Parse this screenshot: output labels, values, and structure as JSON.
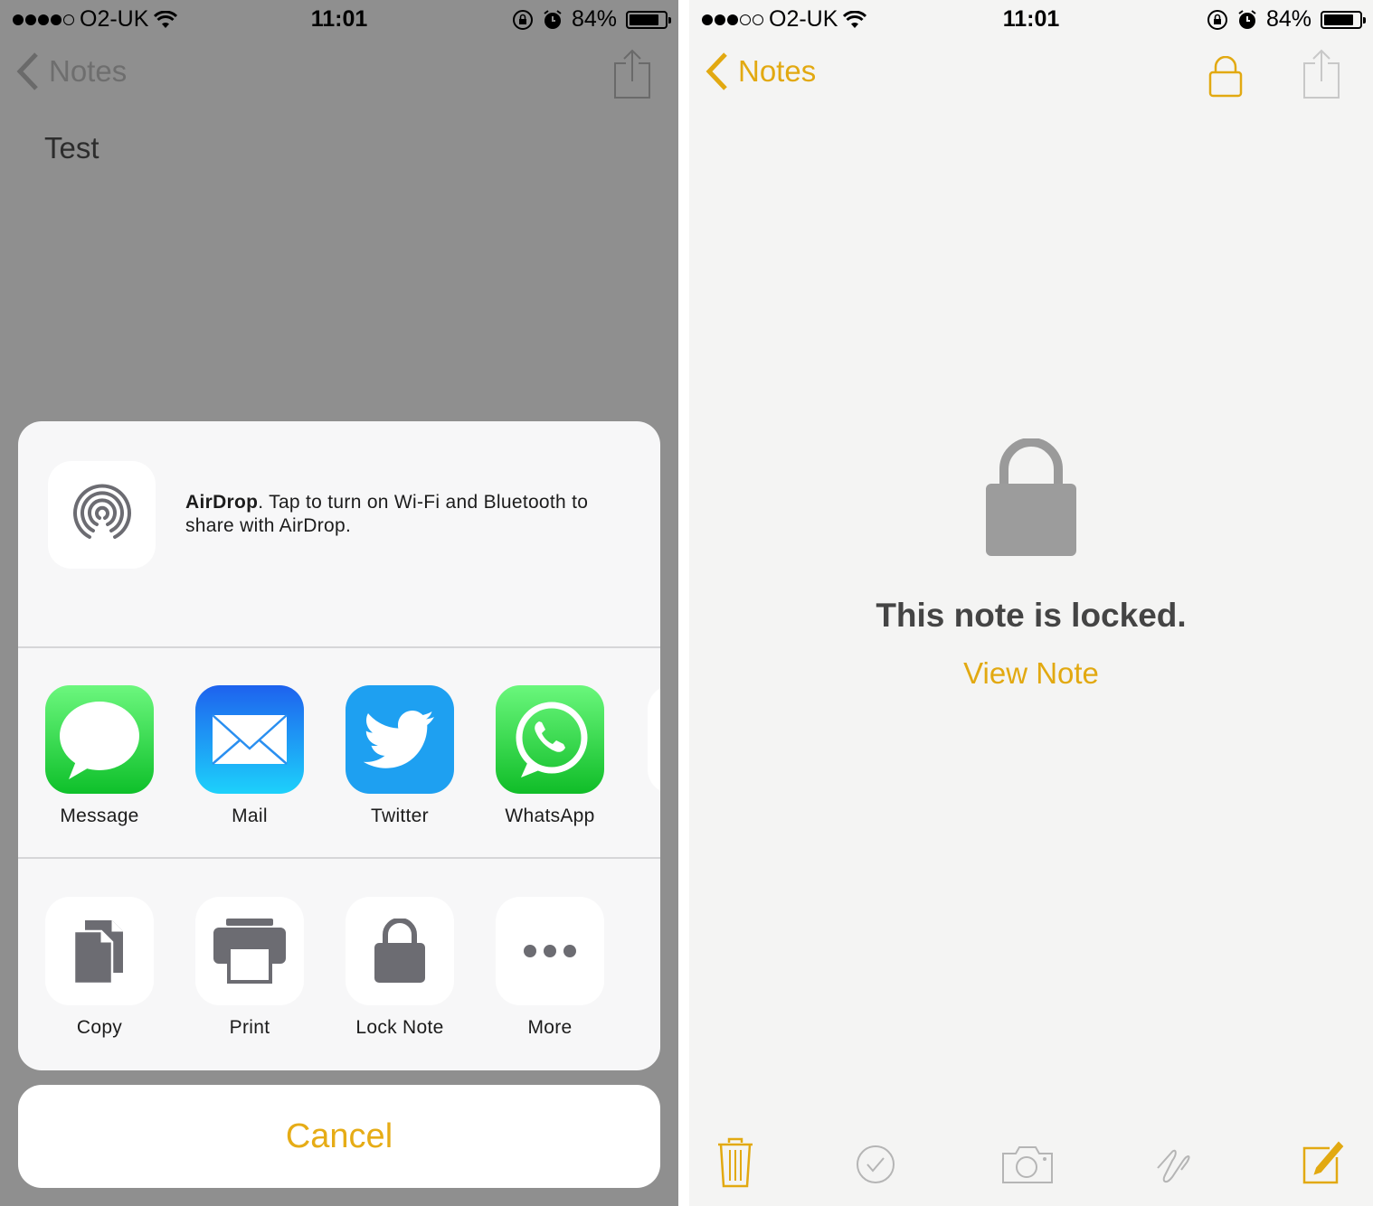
{
  "left_screen": {
    "status_bar": {
      "signal_filled": 4,
      "signal_total": 5,
      "carrier": "O2-UK",
      "time": "11:01",
      "battery_percent": "84%",
      "battery_level": 0.84
    },
    "nav": {
      "back_label": "Notes",
      "share_icon": "share-icon"
    },
    "note_text": "Test",
    "share_sheet": {
      "airdrop": {
        "title": "AirDrop",
        "description": ". Tap to turn on Wi-Fi and Bluetooth to share with AirDrop."
      },
      "apps": [
        {
          "label": "Message",
          "icon": "message-icon",
          "color": "#2fcc4a"
        },
        {
          "label": "Mail",
          "icon": "mail-icon",
          "color": "#1f8af7"
        },
        {
          "label": "Twitter",
          "icon": "twitter-icon",
          "color": "#1da1f2"
        },
        {
          "label": "WhatsApp",
          "icon": "whatsapp-icon",
          "color": "#2bc83e"
        }
      ],
      "actions": [
        {
          "label": "Copy",
          "icon": "copy-icon"
        },
        {
          "label": "Print",
          "icon": "print-icon"
        },
        {
          "label": "Lock Note",
          "icon": "lock-icon"
        },
        {
          "label": "More",
          "icon": "more-icon"
        }
      ],
      "cancel_label": "Cancel"
    }
  },
  "right_screen": {
    "status_bar": {
      "signal_filled": 3,
      "signal_total": 5,
      "carrier": "O2-UK",
      "time": "11:01",
      "battery_percent": "84%",
      "battery_level": 0.84
    },
    "nav": {
      "back_label": "Notes",
      "lock_icon": "lock-icon",
      "share_icon": "share-icon"
    },
    "locked_message": "This note is locked.",
    "view_note_label": "View Note",
    "toolbar": [
      "trash-icon",
      "checklist-icon",
      "camera-icon",
      "sketch-icon",
      "compose-icon"
    ]
  },
  "colors": {
    "accent": "#e2a911",
    "dim_overlay": "#8f8f8f",
    "icon_gray": "#6c6c72"
  }
}
